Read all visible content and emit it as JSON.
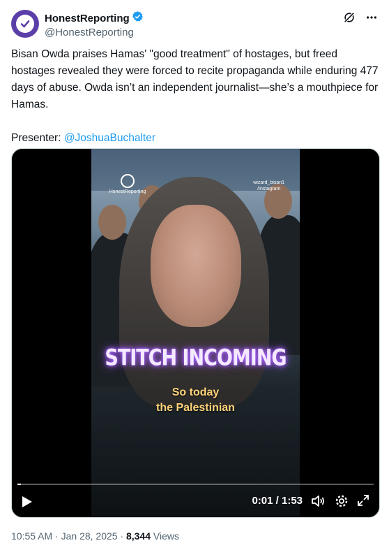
{
  "author": {
    "display_name": "HonestReporting",
    "handle": "@HonestReporting"
  },
  "tweet": {
    "text": "Bisan Owda praises Hamas' \"good treatment\" of hostages, but freed hostages revealed they were forced to recite propaganda while enduring 477 days of abuse. Owda isn’t an independent journalist—she’s a mouthpiece for Hamas.",
    "presenter_label": "Presenter: ",
    "presenter_mention": "@JoshuaBuchalter"
  },
  "video": {
    "watermark_left": "HonestReporting",
    "watermark_right_line1": "wizard_bisan1",
    "watermark_right_line2": "/Instagram",
    "overlay_title": "STITCH INCOMING",
    "caption_line1": "So today",
    "caption_line2": "the Palestinian",
    "time": "0:01 / 1:53",
    "progress": 0.01
  },
  "meta": {
    "timestamp": "10:55 AM · Jan 28, 2025 · ",
    "views_count": "8,344",
    "views_label": " Views"
  },
  "icons": [
    "verified-badge-icon",
    "grok-icon",
    "more-icon",
    "play-icon",
    "volume-icon",
    "settings-icon",
    "fullscreen-icon"
  ],
  "colors": {
    "accent": "#1d9bf0",
    "avatar": "#5b3fa8",
    "overlay_glow": "#9c50ff",
    "caption": "#ffd37a"
  }
}
